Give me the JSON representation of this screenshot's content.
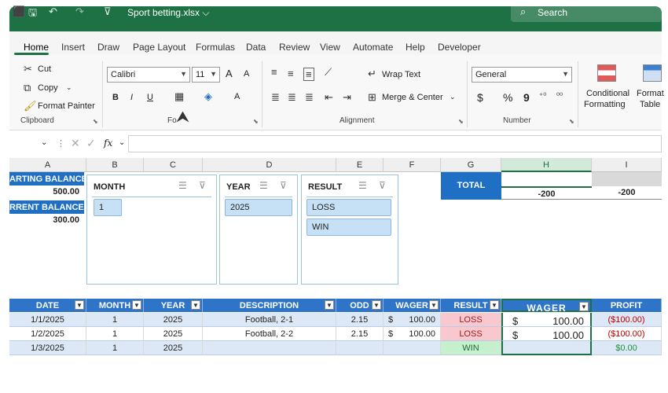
{
  "window": {
    "title": "Sport betting.xlsx ⌵",
    "search_label": "Search"
  },
  "tabs": [
    "Home",
    "Insert",
    "Draw",
    "Page Layout",
    "Formulas",
    "Data",
    "Review",
    "View",
    "Automate",
    "Help",
    "Developer"
  ],
  "ribbon": {
    "clipboard": {
      "cut": "Cut",
      "copy": "Copy",
      "format_painter": "Format Painter",
      "group": "Clipboard"
    },
    "font": {
      "name": "Calibri",
      "size": "11",
      "grow": "A",
      "shrink": "A",
      "bold": "B",
      "italic": "I",
      "underline": "U",
      "font_color": "A",
      "group": "Fo"
    },
    "alignment": {
      "wrap": "Wrap Text",
      "merge": "Merge & Center",
      "group": "Alignment"
    },
    "number": {
      "format": "General",
      "currency": "$",
      "percent": "%",
      "comma": "9",
      "group": "Number"
    },
    "styles": {
      "conditional_1": "Conditional",
      "conditional_2": "Formatting",
      "format_table_1": "Format",
      "format_table_2": "Table"
    }
  },
  "formula_bar": {
    "fx": "fx",
    "value": ""
  },
  "columns": [
    {
      "letter": "A",
      "selected": false
    },
    {
      "letter": "B",
      "selected": false
    },
    {
      "letter": "C",
      "selected": false
    },
    {
      "letter": "D",
      "selected": false
    },
    {
      "letter": "E",
      "selected": false
    },
    {
      "letter": "F",
      "selected": false
    },
    {
      "letter": "G",
      "selected": false
    },
    {
      "letter": "H",
      "selected": true
    },
    {
      "letter": "I",
      "selected": false
    }
  ],
  "balance": {
    "starting_label": "ARTING BALANCE",
    "starting_value": "500.00",
    "current_label": "RRENT BALANCE",
    "current_value": "300.00"
  },
  "slicers": {
    "month": {
      "title": "MONTH",
      "items": [
        "1"
      ]
    },
    "year": {
      "title": "YEAR",
      "items": [
        "2025"
      ]
    },
    "result": {
      "title": "RESULT",
      "items": [
        "LOSS",
        "WIN"
      ]
    }
  },
  "total": {
    "label": "TOTAL",
    "h": "-200",
    "i": "-200"
  },
  "table": {
    "headers": [
      "DATE",
      "MONTH",
      "YEAR",
      "DESCRIPTION",
      "ODD",
      "WAGER",
      "RESULT",
      "WAGER",
      "PROFIT"
    ],
    "rows": [
      {
        "date": "1/1/2025",
        "month": "1",
        "year": "2025",
        "desc": "Football, 2-1",
        "odd": "2.15",
        "cur": "$",
        "wager": "100.00",
        "result": "LOSS",
        "cur2": "$",
        "wager2": "100.00",
        "profit": "($100.00)"
      },
      {
        "date": "1/2/2025",
        "month": "1",
        "year": "2025",
        "desc": "Football, 2-2",
        "odd": "2.15",
        "cur": "$",
        "wager": "100.00",
        "result": "LOSS",
        "cur2": "$",
        "wager2": "100.00",
        "profit": "($100.00)"
      },
      {
        "date": "1/3/2025",
        "month": "1",
        "year": "2025",
        "desc": "",
        "odd": "",
        "cur": "",
        "wager": "",
        "result": "WIN",
        "cur2": "",
        "wager2": "",
        "profit": "$0.00"
      }
    ]
  },
  "colors": {
    "excel_green": "#1e7145",
    "header_blue": "#2e75c9",
    "loss_red": "#c00000",
    "win_green": "#1f8f3e"
  }
}
